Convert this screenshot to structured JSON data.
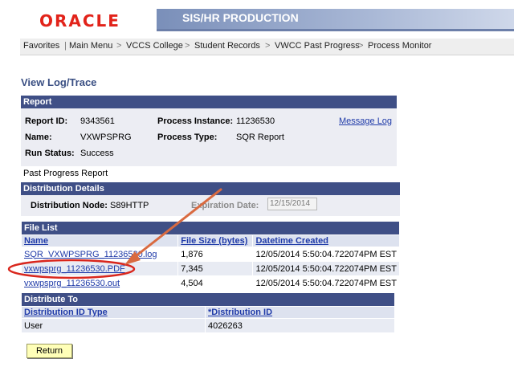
{
  "header": {
    "logo": "ORACLE",
    "title": "SIS/HR PRODUCTION"
  },
  "nav": {
    "items": [
      "Favorites",
      "Main Menu",
      "VCCS College",
      "Student Records",
      "VWCC Past Progress",
      "Process Monitor"
    ],
    "sep": ">"
  },
  "page_title": "View Log/Trace",
  "report": {
    "header": "Report",
    "report_id_label": "Report ID:",
    "report_id": "9343561",
    "process_instance_label": "Process Instance:",
    "process_instance": "11236530",
    "message_log": "Message Log",
    "name_label": "Name:",
    "name": "VXWPSPRG",
    "process_type_label": "Process Type:",
    "process_type": "SQR Report",
    "run_status_label": "Run Status:",
    "run_status": "Success",
    "description": "Past Progress Report"
  },
  "distribution_details": {
    "header": "Distribution Details",
    "node_label": "Distribution Node:",
    "node": "S89HTTP",
    "expiration_label": "Expiration Date:",
    "expiration": "12/15/2014"
  },
  "file_list": {
    "header": "File List",
    "columns": [
      "Name",
      "File Size (bytes)",
      "Datetime Created"
    ],
    "rows": [
      {
        "name": "SQR_VXWPSPRG_11236530.log",
        "size": "1,876",
        "datetime": "12/05/2014  5:50:04.722074PM EST"
      },
      {
        "name": "vxwpsprg_11236530.PDF",
        "size": "7,345",
        "datetime": "12/05/2014  5:50:04.722074PM EST"
      },
      {
        "name": "vxwpsprg_11236530.out",
        "size": "4,504",
        "datetime": "12/05/2014  5:50:04.722074PM EST"
      }
    ]
  },
  "distribute_to": {
    "header": "Distribute To",
    "columns": [
      "Distribution ID Type",
      "*Distribution ID"
    ],
    "rows": [
      {
        "type": "User",
        "id": "4026263"
      }
    ]
  },
  "return_label": "Return",
  "colors": {
    "brand_red": "#e2231a",
    "header_blue": "#3f4f86",
    "link_blue": "#1f3aa8",
    "annotation_red": "#d9261c"
  }
}
